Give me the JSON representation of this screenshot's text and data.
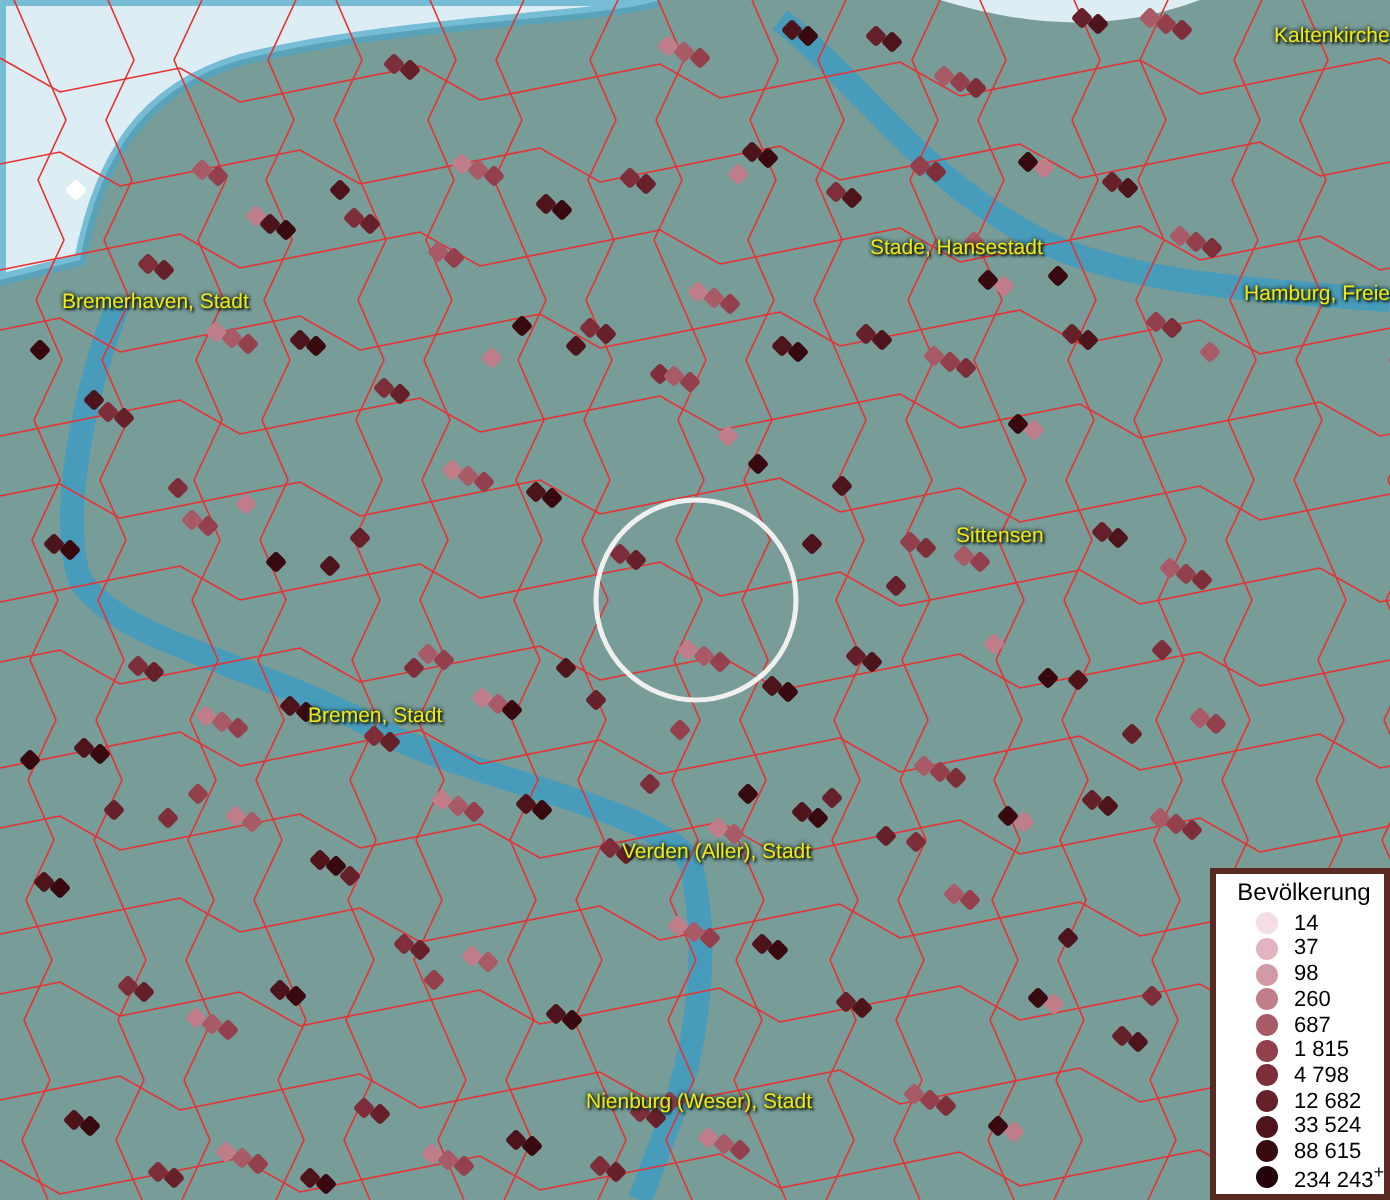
{
  "map": {
    "places": [
      {
        "name": "Kaltenkirche"
      },
      {
        "name": "Stade, Hansestadt"
      },
      {
        "name": "Bremerhaven, Stadt"
      },
      {
        "name": "Hamburg, Freie"
      },
      {
        "name": "Sittensen"
      },
      {
        "name": "Bremen, Stadt"
      },
      {
        "name": "Verden (Aller), Stadt"
      },
      {
        "name": "Nienburg (Weser), Stadt"
      }
    ]
  },
  "legend": {
    "title": "Bevölkerung",
    "items": [
      {
        "label": "14",
        "color": "#f4dde6"
      },
      {
        "label": "37",
        "color": "#e2b4c0"
      },
      {
        "label": "98",
        "color": "#d29aa6"
      },
      {
        "label": "260",
        "color": "#c07e8a"
      },
      {
        "label": "687",
        "color": "#a85a66"
      },
      {
        "label": "1 815",
        "color": "#94404c"
      },
      {
        "label": "4 798",
        "color": "#7e2e38"
      },
      {
        "label": "12 682",
        "color": "#66202a"
      },
      {
        "label": "33 524",
        "color": "#4e141c"
      },
      {
        "label": "88 615",
        "color": "#380a10"
      },
      {
        "label": "234 243$^{+}$",
        "color": "#22040a"
      }
    ]
  }
}
